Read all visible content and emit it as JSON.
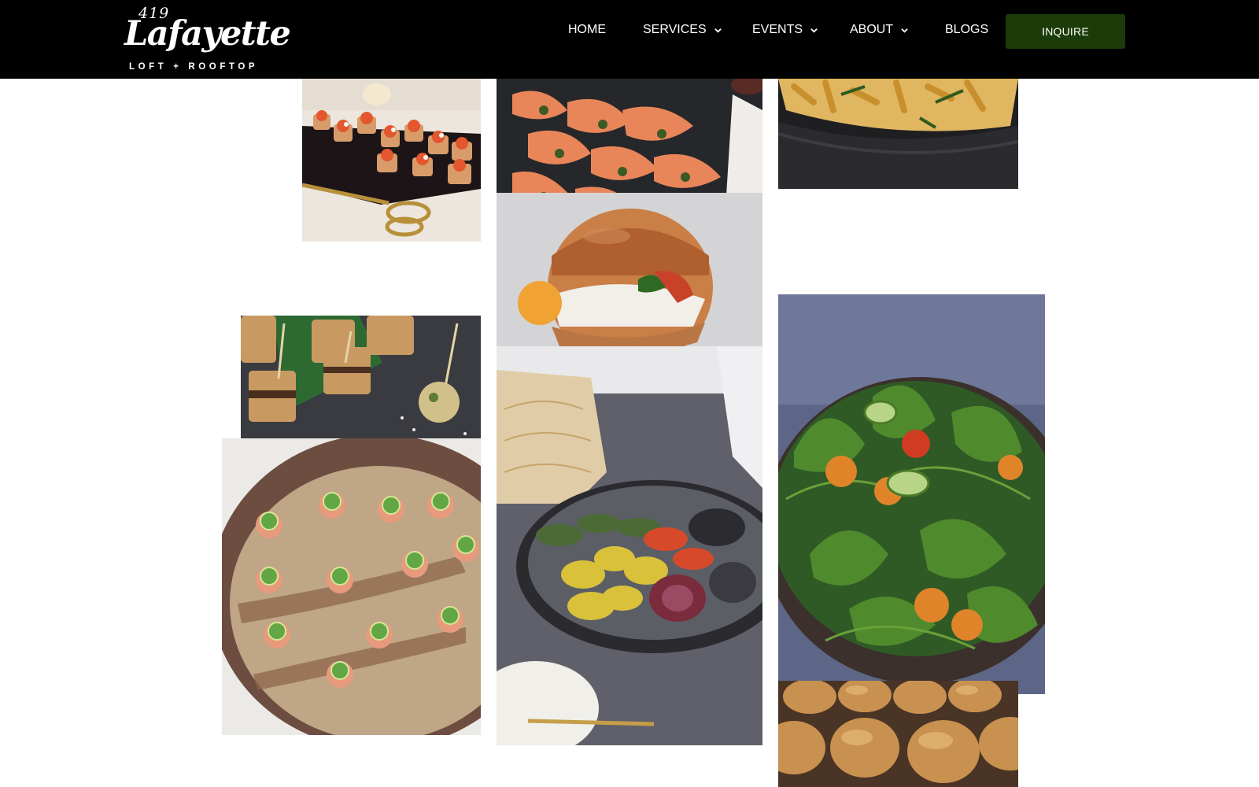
{
  "header": {
    "logo": {
      "number": "419",
      "name": "Lafayette",
      "tagline": "LOFT + ROOFTOP"
    },
    "nav": [
      {
        "label": "HOME",
        "dropdown": false
      },
      {
        "label": "SERVICES",
        "dropdown": true
      },
      {
        "label": "EVENTS",
        "dropdown": true
      },
      {
        "label": "ABOUT",
        "dropdown": true
      },
      {
        "label": "BLOGS",
        "dropdown": false
      }
    ],
    "cta_label": "INQUIRE",
    "colors": {
      "background": "#000000",
      "cta_background": "#1b3b08",
      "text": "#ffffff"
    }
  },
  "gallery": {
    "photos": [
      {
        "subject": "smoked salmon toast bites on black tray with gold tongs"
      },
      {
        "subject": "sliced cured salmon with herbs on dark plate"
      },
      {
        "subject": "penne pasta with basil in black bowl"
      },
      {
        "subject": "egg and tomato brioche sandwich"
      },
      {
        "subject": "grilled sandwich skewers and mini bites on slate"
      },
      {
        "subject": "tuna bites with jalapeno slices on sesame platter"
      },
      {
        "subject": "grilled vegetables platter with pita chips and dip"
      },
      {
        "subject": "mixed greens salad with cherry tomatoes and cucumber"
      },
      {
        "subject": "mini slider buns"
      }
    ]
  }
}
